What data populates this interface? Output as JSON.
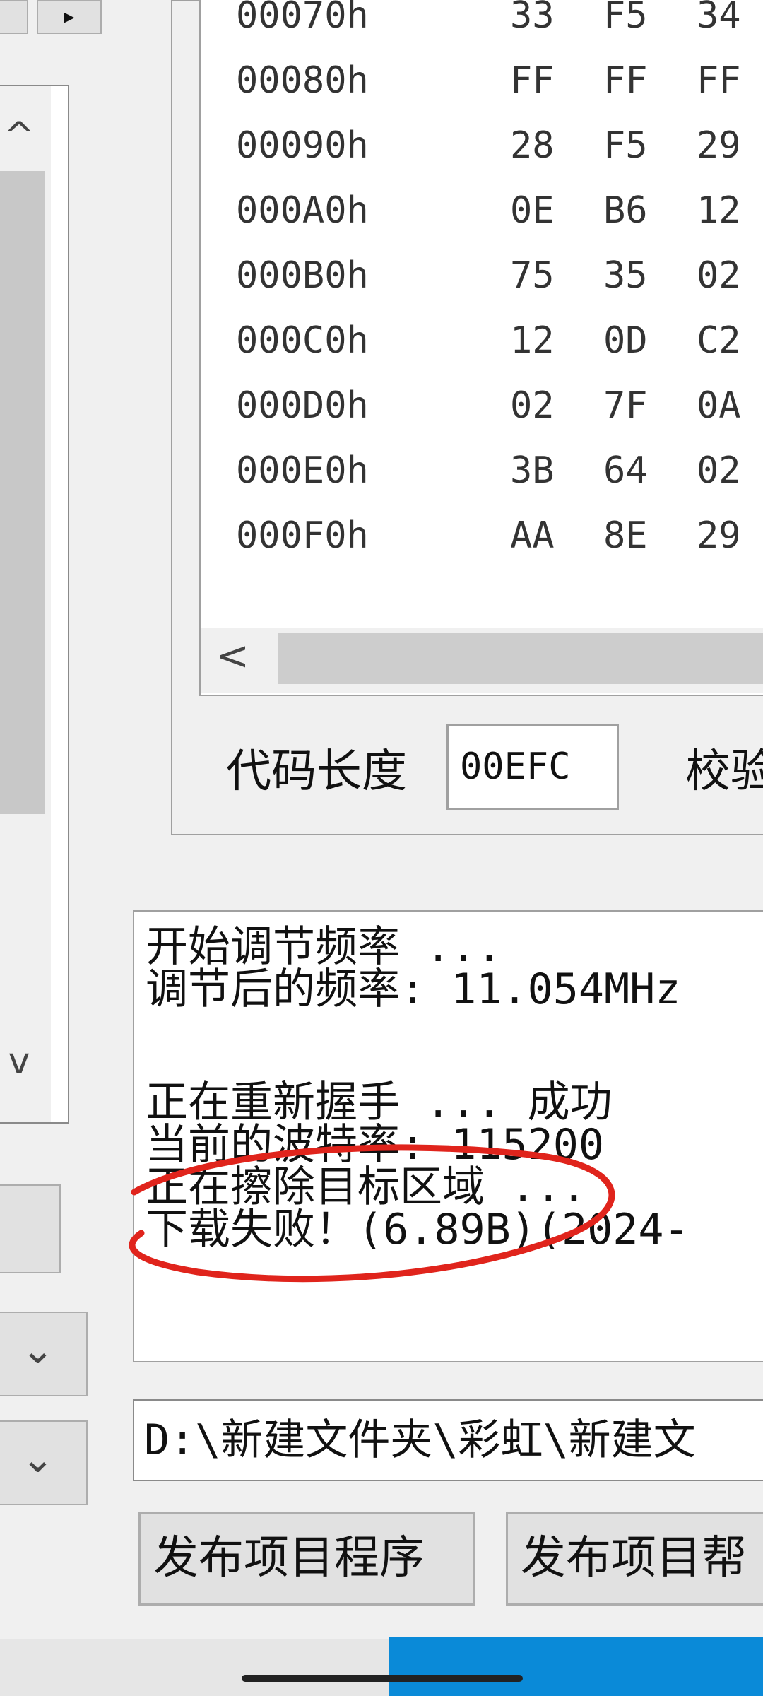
{
  "toolbar": {
    "left_glyph": "",
    "right_glyph": "▸"
  },
  "hex": {
    "rows": [
      {
        "addr": "00070h",
        "bytes": [
          "33",
          "F5",
          "34"
        ]
      },
      {
        "addr": "00080h",
        "bytes": [
          "FF",
          "FF",
          "FF"
        ]
      },
      {
        "addr": "00090h",
        "bytes": [
          "28",
          "F5",
          "29"
        ]
      },
      {
        "addr": "000A0h",
        "bytes": [
          "0E",
          "B6",
          "12"
        ]
      },
      {
        "addr": "000B0h",
        "bytes": [
          "75",
          "35",
          "02"
        ]
      },
      {
        "addr": "000C0h",
        "bytes": [
          "12",
          "0D",
          "C2"
        ]
      },
      {
        "addr": "000D0h",
        "bytes": [
          "02",
          "7F",
          "0A"
        ]
      },
      {
        "addr": "000E0h",
        "bytes": [
          "3B",
          "64",
          "02"
        ]
      },
      {
        "addr": "000F0h",
        "bytes": [
          "AA",
          "8E",
          "29"
        ]
      }
    ],
    "hscroll_left": "<"
  },
  "code_length": {
    "label": "代码长度",
    "value": "00EFC",
    "checksum_label": "校验"
  },
  "log": {
    "lines": [
      "开始调节频率 ...",
      "调节后的频率: 11.054MHz",
      "",
      "正在重新握手 ... 成功",
      "当前的波特率: 115200",
      "正在擦除目标区域 ...",
      "下载失败！(6.89B)(2024-"
    ]
  },
  "left_panel": {
    "up_arrow": "^",
    "down_arrow": "v"
  },
  "combos": {
    "chevron": "⌄"
  },
  "path": {
    "value": "D:\\新建文件夹\\彩虹\\新建文"
  },
  "buttons": {
    "publish_program": "发布项目程序",
    "publish_help": "发布项目帮"
  },
  "colors": {
    "annotation": "#e0241c",
    "taskbar_accent": "#0a8ad8"
  }
}
